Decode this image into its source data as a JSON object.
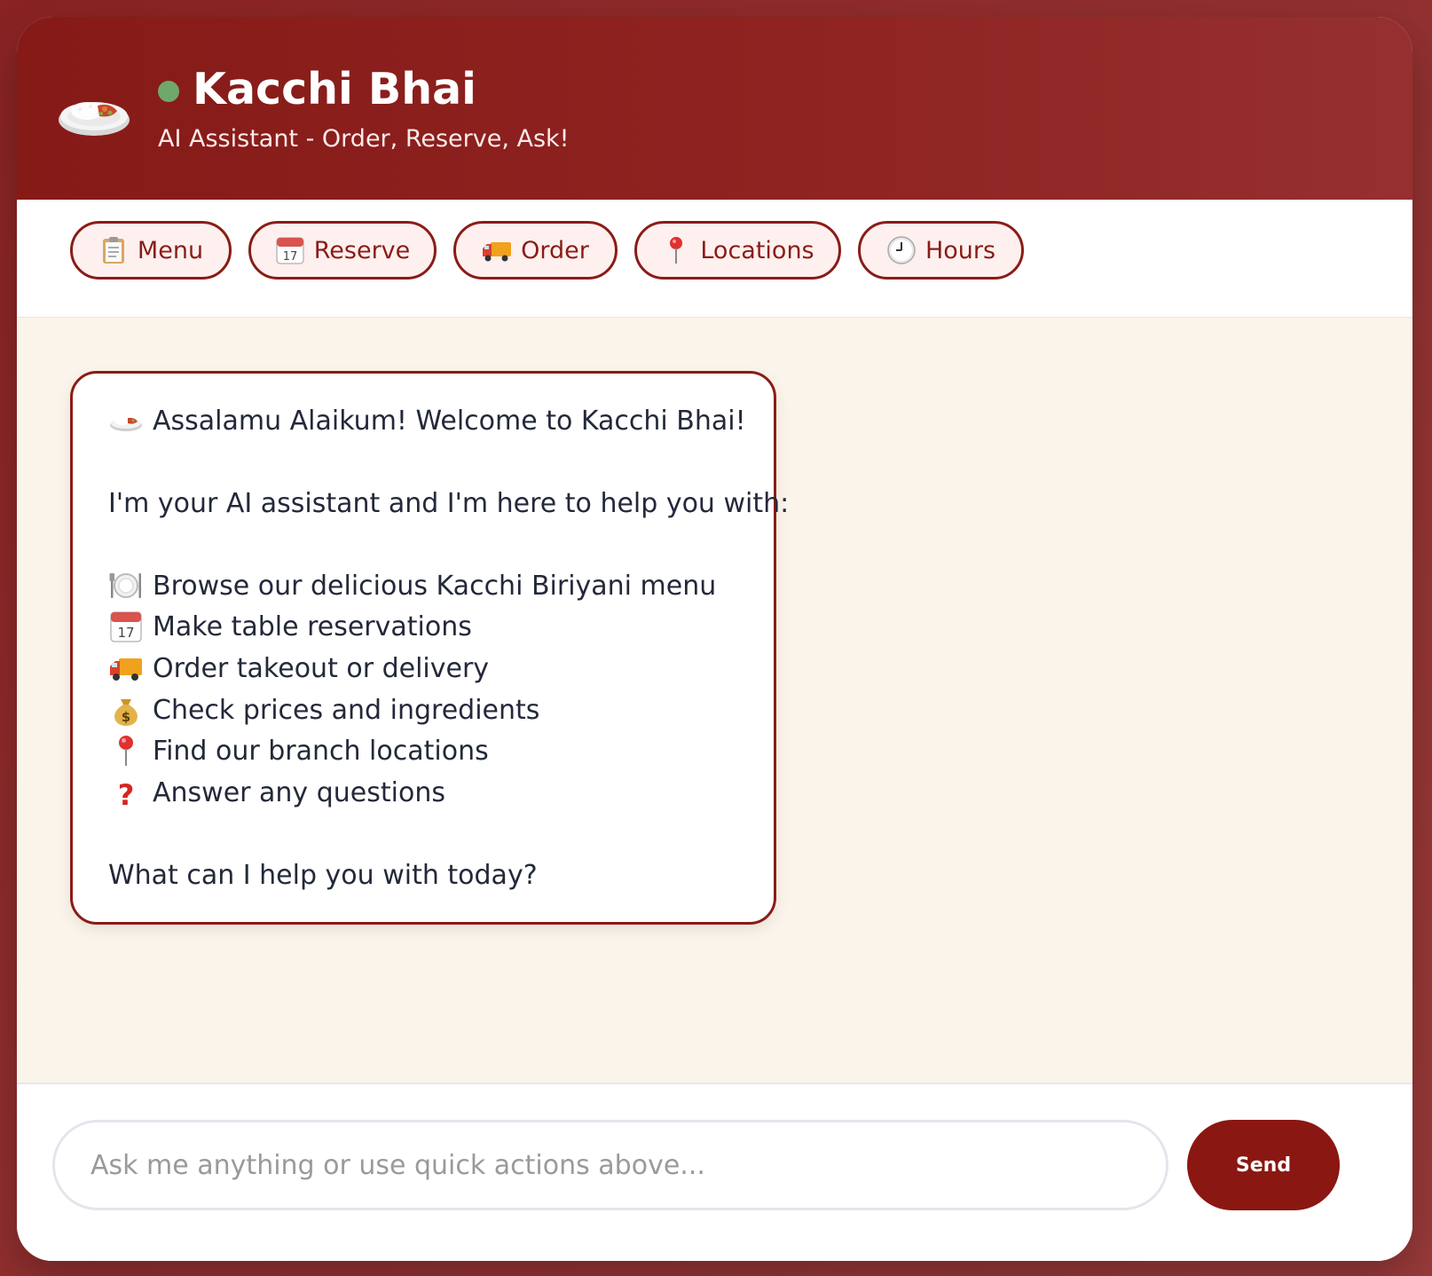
{
  "header": {
    "title": "Kacchi Bhai",
    "subtitle": "AI Assistant - Order, Reserve, Ask!",
    "logo_icon": "biryani-plate-icon",
    "status_color": "#6fa86a"
  },
  "quick_actions": [
    {
      "label": "Menu",
      "icon": "clipboard-icon"
    },
    {
      "label": "Reserve",
      "icon": "calendar-icon"
    },
    {
      "label": "Order",
      "icon": "delivery-truck-icon"
    },
    {
      "label": "Locations",
      "icon": "map-pin-icon"
    },
    {
      "label": "Hours",
      "icon": "clock-icon"
    }
  ],
  "message": {
    "greeting": "Assalamu Alaikum! Welcome to Kacchi Bhai!",
    "intro": "I'm your AI assistant and I'm here to help you with:",
    "items": [
      {
        "icon": "plate-cutlery-icon",
        "text": "Browse our delicious Kacchi Biriyani menu"
      },
      {
        "icon": "calendar-icon",
        "text": "Make table reservations"
      },
      {
        "icon": "delivery-truck-icon",
        "text": "Order takeout or delivery"
      },
      {
        "icon": "money-bag-icon",
        "text": "Check prices and ingredients"
      },
      {
        "icon": "map-pin-icon",
        "text": "Find our branch locations"
      },
      {
        "icon": "question-mark-icon",
        "text": "Answer any questions"
      }
    ],
    "closing": "What can I help you with today?"
  },
  "composer": {
    "placeholder": "Ask me anything or use quick actions above...",
    "value": "",
    "send_label": "Send"
  },
  "colors": {
    "brand": "#8a1c17",
    "chat_background": "#fbf4ea"
  }
}
